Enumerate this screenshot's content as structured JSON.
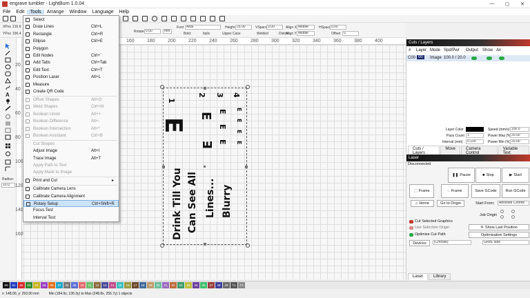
{
  "window": {
    "title": "engrave tumbler - LightBurn 1.0.04",
    "minimize": "—",
    "maximize": "▢",
    "close": "✕"
  },
  "menubar": [
    "File",
    "Edit",
    "Tools",
    "Arrange",
    "Window",
    "Language",
    "Help"
  ],
  "props": {
    "xpos_label": "XPos",
    "xpos_value": "216.6",
    "ypos_label": "YPos",
    "ypos_value": "196.4",
    "rotate_label": "Rotate",
    "rotate_value": "0.00",
    "rotate_unit": "mm",
    "font_label": "Font",
    "font_value": "Arial",
    "height_label": "Height",
    "height_value": "25.00",
    "hspace_label": "HSpace",
    "hspace_value": "0.00",
    "vspace_label": "VSpace",
    "vspace_value": "0.00",
    "alignx_label": "Align X",
    "alignx_value": "Middle",
    "aligny_label": "Align Y",
    "aligny_value": "Middle",
    "offset_label": "Offset",
    "offset_value": "0",
    "bold": "Bold",
    "italic": "Italic",
    "upper": "Upper Case",
    "welded": "Welded",
    "distort": "Distort"
  },
  "radius": {
    "label": "Radius:",
    "value": "10.0"
  },
  "rulers": {
    "top": [
      "160",
      "180",
      "200",
      "220",
      "240",
      "260",
      "280",
      "300",
      "320",
      "340",
      "360",
      "380",
      "400"
    ],
    "left": [
      "20",
      "40",
      "60",
      "80",
      "100",
      "120",
      "140",
      "160"
    ]
  },
  "artwork": {
    "numbers": [
      "1",
      "2",
      "3",
      "4"
    ],
    "lines": [
      "Drink Till You",
      "Can See All",
      "Lines...",
      "Blurry"
    ],
    "letter": "E"
  },
  "menu": {
    "items": [
      {
        "label": "Select",
        "shortcut": "",
        "disabled": false,
        "icon": "select-icon"
      },
      {
        "label": "Draw Lines",
        "shortcut": "Ctrl+L",
        "disabled": false,
        "icon": "draw-lines-icon"
      },
      {
        "label": "Rectangle",
        "shortcut": "Ctrl+R",
        "disabled": false,
        "icon": "rectangle-icon"
      },
      {
        "label": "Ellipse",
        "shortcut": "Ctrl+E",
        "disabled": false,
        "icon": "ellipse-icon"
      },
      {
        "label": "Polygon",
        "shortcut": "",
        "disabled": false,
        "icon": "polygon-icon"
      },
      {
        "label": "Edit Nodes",
        "shortcut": "Ctrl+`",
        "disabled": false,
        "icon": "edit-nodes-icon"
      },
      {
        "label": "Add Tabs",
        "shortcut": "Ctrl+Tab",
        "disabled": false,
        "icon": "add-tabs-icon"
      },
      {
        "label": "Edit Text",
        "shortcut": "Ctrl+T",
        "disabled": false,
        "icon": "text-icon"
      },
      {
        "label": "Position Laser",
        "shortcut": "Alt+L",
        "disabled": false,
        "icon": "position-laser-icon"
      },
      {
        "label": "Measure",
        "shortcut": "",
        "disabled": false,
        "icon": "measure-icon"
      },
      {
        "label": "Create QR Code",
        "shortcut": "",
        "disabled": false,
        "icon": "qr-code-icon"
      },
      {
        "label": "Offset Shapes",
        "shortcut": "Alt+O",
        "disabled": true,
        "icon": "offset-shapes-icon"
      },
      {
        "label": "Weld Shapes",
        "shortcut": "Ctrl+W",
        "disabled": true,
        "icon": "weld-shapes-icon"
      },
      {
        "label": "Boolean Union",
        "shortcut": "Alt++",
        "disabled": true,
        "icon": "boolean-union-icon"
      },
      {
        "label": "Boolean Difference",
        "shortcut": "Alt+-",
        "disabled": true,
        "icon": "boolean-difference-icon"
      },
      {
        "label": "Boolean Intersection",
        "shortcut": "Alt+*",
        "disabled": true,
        "icon": "boolean-intersection-icon"
      },
      {
        "label": "Boolean Assistant",
        "shortcut": "Ctrl+B",
        "disabled": true,
        "icon": "boolean-assistant-icon"
      },
      {
        "label": "Cut Shapes",
        "shortcut": "",
        "disabled": true,
        "icon": ""
      },
      {
        "label": "Adjust Image",
        "shortcut": "Alt+I",
        "disabled": false,
        "icon": ""
      },
      {
        "label": "Trace Image",
        "shortcut": "Alt+T",
        "disabled": false,
        "icon": ""
      },
      {
        "label": "Apply Path to Text",
        "shortcut": "",
        "disabled": true,
        "icon": ""
      },
      {
        "label": "Apply Mask to Image",
        "shortcut": "",
        "disabled": true,
        "icon": ""
      },
      {
        "label": "Print and Cut",
        "shortcut": "▸",
        "disabled": false,
        "icon": "print-cut-icon"
      },
      {
        "label": "Calibrate Camera Lens",
        "shortcut": "",
        "disabled": false,
        "icon": "camera-icon"
      },
      {
        "label": "Calibrate Camera Alignment",
        "shortcut": "",
        "disabled": false,
        "icon": "camera-icon"
      },
      {
        "label": "Rotary Setup",
        "shortcut": "Ctrl+Shift+R",
        "disabled": false,
        "icon": "rotary-icon"
      },
      {
        "label": "Focus Test",
        "shortcut": "",
        "disabled": false,
        "icon": ""
      },
      {
        "label": "Interval Test",
        "shortcut": "",
        "disabled": false,
        "icon": ""
      }
    ]
  },
  "cuts": {
    "title": "Cuts / Layers",
    "headers": [
      "#",
      "Layer",
      "Mode",
      "Spd/Pwr",
      "Output",
      "Show",
      "Air"
    ],
    "row": {
      "num": "C00",
      "layer": "00",
      "mode": "Image",
      "spdpwr": "100.0 / 20.0"
    },
    "layer_color_label": "Layer Color",
    "pass_count_label": "Pass Count",
    "pass_count_value": "1",
    "interval_label": "Interval (mm)",
    "interval_value": "0.100",
    "speed_label": "Speed (mm/s)",
    "speed_value": "100.0",
    "powermax_label": "Power Max (%)",
    "powermax_value": "20.00",
    "powermin_label": "Power Min (%)",
    "powermin_value": "20.00",
    "tabs": [
      "Cuts / Layers",
      "Move",
      "Camera Control",
      "Variable Text"
    ]
  },
  "laser": {
    "title": "Laser",
    "status": "Disconnected",
    "pause": "Pause",
    "stop": "Stop",
    "start": "Start",
    "frame1": "Frame",
    "frame2": "Frame",
    "save": "Save GCode",
    "run": "Run GCode",
    "home": "Home",
    "goto": "Go to Origin",
    "start_from_label": "Start From:",
    "start_from_value": "Absolute Coords",
    "job_origin": "Job Origin",
    "cut_selected": "Cut Selected Graphics",
    "use_selection": "Use Selection Origin",
    "show_last": "Show Last Position",
    "optimize": "Optimize Cut Path",
    "opt_settings": "Optimization Settings",
    "devices": "Devices",
    "device_choice": "(Choose)",
    "controller": "GRBL lase",
    "tabs": [
      "Laser",
      "Library"
    ]
  },
  "palette": [
    "00",
    "01",
    "02",
    "03",
    "04",
    "05",
    "06",
    "07",
    "08",
    "09",
    "10",
    "11",
    "12",
    "13",
    "14",
    "15",
    "16",
    "17",
    "18",
    "19",
    "20",
    "21",
    "22",
    "23",
    "24",
    "25",
    "26",
    "27",
    "28",
    "29",
    "T1",
    "T2"
  ],
  "palette_colors": [
    "#111111",
    "#1f3fbf",
    "#d62b2b",
    "#2e8b2e",
    "#c9b21f",
    "#9b3fbf",
    "#e0701f",
    "#1fa7c9",
    "#777777",
    "#5b6fd6",
    "#e26b6b",
    "#6bbf6b",
    "#8a6b3f",
    "#4b4b9b",
    "#bf4b8a",
    "#3fbfbf",
    "#9b9b3f",
    "#6b4b2b",
    "#3f6b9b",
    "#bf9b6b",
    "#6bbf9b",
    "#9b6bbf",
    "#bf6b3f",
    "#3f9b6b",
    "#bfbf3f",
    "#6b3f9b",
    "#3fbf6b",
    "#9b3f3f",
    "#3f3f9b",
    "#6b6b6b",
    "#555555",
    "#888888"
  ],
  "status": {
    "coords": "x: 148.00, y: 293.00 mm",
    "minmax": "Min (184.9x, 136.3y) to Max (248.8x, 256.7y)   1 objects"
  }
}
